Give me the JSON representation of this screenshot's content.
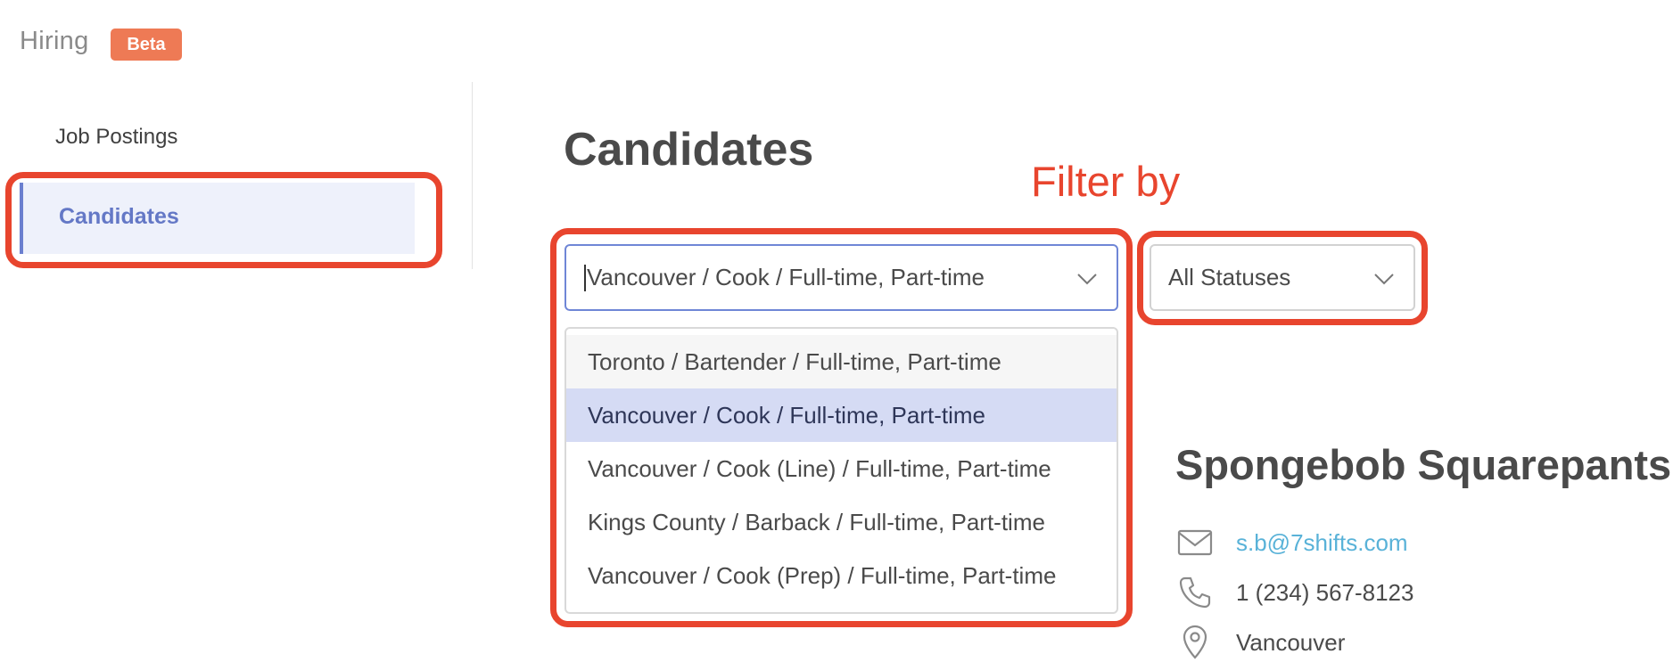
{
  "app": {
    "title": "Hiring",
    "badge": "Beta"
  },
  "sidebar": {
    "items": [
      {
        "label": "Job Postings",
        "active": false
      },
      {
        "label": "Candidates",
        "active": true
      }
    ]
  },
  "page": {
    "title": "Candidates"
  },
  "annotation": {
    "label": "Filter by",
    "color": "#e8452e"
  },
  "filters": {
    "job_select": {
      "value": "Vancouver / Cook / Full-time, Part-time",
      "options": [
        "Toronto / Bartender / Full-time, Part-time",
        "Vancouver / Cook / Full-time, Part-time",
        "Vancouver / Cook (Line) / Full-time, Part-time",
        "Kings County / Barback / Full-time, Part-time",
        "Vancouver / Cook (Prep) / Full-time, Part-time"
      ],
      "selected_index": 1
    },
    "status_select": {
      "value": "All Statuses"
    }
  },
  "candidate": {
    "name": "Spongebob Squarepants",
    "email": "s.b@7shifts.com",
    "phone": "1 (234) 567-8123",
    "location": "Vancouver"
  },
  "colors": {
    "accent": "#6478c6",
    "badge": "#ee7a55",
    "annotation": "#e8452e",
    "link": "#59b2d8",
    "selected_option": "#d5dbf4"
  },
  "icons": [
    "mail-icon",
    "phone-icon",
    "location-pin-icon",
    "chevron-down-icon"
  ]
}
